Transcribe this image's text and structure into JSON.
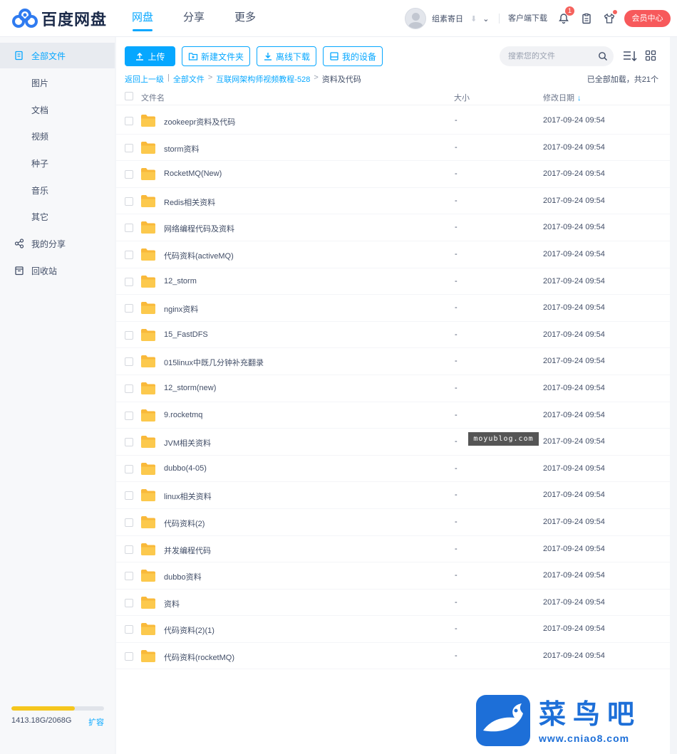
{
  "brand": {
    "name": "百度网盘"
  },
  "nav": [
    {
      "label": "网盘",
      "active": true
    },
    {
      "label": "分享",
      "active": false
    },
    {
      "label": "更多",
      "active": false
    }
  ],
  "user": {
    "name": "组素寄日",
    "client_download": "客户端下载",
    "notification_count": "1",
    "vip_center": "会员中心"
  },
  "sidebar": {
    "items": [
      {
        "label": "全部文件",
        "icon": "all-files-icon",
        "active": true
      },
      {
        "label": "图片"
      },
      {
        "label": "文档"
      },
      {
        "label": "视频"
      },
      {
        "label": "种子"
      },
      {
        "label": "音乐"
      },
      {
        "label": "其它"
      },
      {
        "label": "我的分享",
        "icon": "share-icon"
      },
      {
        "label": "回收站",
        "icon": "trash-icon"
      }
    ],
    "quota": {
      "text": "1413.18G/2068G",
      "used_fraction": 0.683,
      "expand": "扩容"
    }
  },
  "toolbar": {
    "upload": "上传",
    "new_folder": "新建文件夹",
    "offline_download": "离线下载",
    "my_devices": "我的设备",
    "search_placeholder": "搜索您的文件"
  },
  "breadcrumb": {
    "back": "返回上一级",
    "items": [
      "全部文件",
      "互联网架构师视频教程-528"
    ],
    "current": "资料及代码"
  },
  "loaded_status": "已全部加载，共21个",
  "table": {
    "headers": {
      "name": "文件名",
      "size": "大小",
      "date": "修改日期"
    },
    "rows": [
      {
        "name": "zookeepr资料及代码",
        "size": "-",
        "date": "2017-09-24 09:54"
      },
      {
        "name": "storm资料",
        "size": "-",
        "date": "2017-09-24 09:54"
      },
      {
        "name": "RocketMQ(New)",
        "size": "-",
        "date": "2017-09-24 09:54"
      },
      {
        "name": "Redis相关资料",
        "size": "-",
        "date": "2017-09-24 09:54"
      },
      {
        "name": "网络编程代码及资料",
        "size": "-",
        "date": "2017-09-24 09:54"
      },
      {
        "name": "代码资料(activeMQ)",
        "size": "-",
        "date": "2017-09-24 09:54"
      },
      {
        "name": "12_storm",
        "size": "-",
        "date": "2017-09-24 09:54"
      },
      {
        "name": "nginx资料",
        "size": "-",
        "date": "2017-09-24 09:54"
      },
      {
        "name": "15_FastDFS",
        "size": "-",
        "date": "2017-09-24 09:54"
      },
      {
        "name": "015linux中既几分钟补充翻录",
        "size": "-",
        "date": "2017-09-24 09:54"
      },
      {
        "name": "12_storm(new)",
        "size": "-",
        "date": "2017-09-24 09:54"
      },
      {
        "name": "9.rocketmq",
        "size": "-",
        "date": "2017-09-24 09:54"
      },
      {
        "name": "JVM相关资料",
        "size": "-",
        "date": "2017-09-24 09:54"
      },
      {
        "name": "dubbo(4-05)",
        "size": "-",
        "date": "2017-09-24 09:54"
      },
      {
        "name": "linux相关资料",
        "size": "-",
        "date": "2017-09-24 09:54"
      },
      {
        "name": "代码资料(2)",
        "size": "-",
        "date": "2017-09-24 09:54"
      },
      {
        "name": "并发编程代码",
        "size": "-",
        "date": "2017-09-24 09:54"
      },
      {
        "name": "dubbo资料",
        "size": "-",
        "date": "2017-09-24 09:54"
      },
      {
        "name": "资料",
        "size": "-",
        "date": "2017-09-24 09:54"
      },
      {
        "name": "代码资料(2)(1)",
        "size": "-",
        "date": "2017-09-24 09:54"
      },
      {
        "name": "代码资料(rocketMQ)",
        "size": "-",
        "date": "2017-09-24 09:54"
      }
    ]
  },
  "watermarks": {
    "tag": "moyublog.com",
    "logo_title": "菜鸟吧",
    "logo_url": "www.cniao8.com"
  },
  "colors": {
    "accent": "#06a7ff",
    "folder": "#fcc94d",
    "vip": "#f7595b",
    "quota": "#f5c61d"
  }
}
